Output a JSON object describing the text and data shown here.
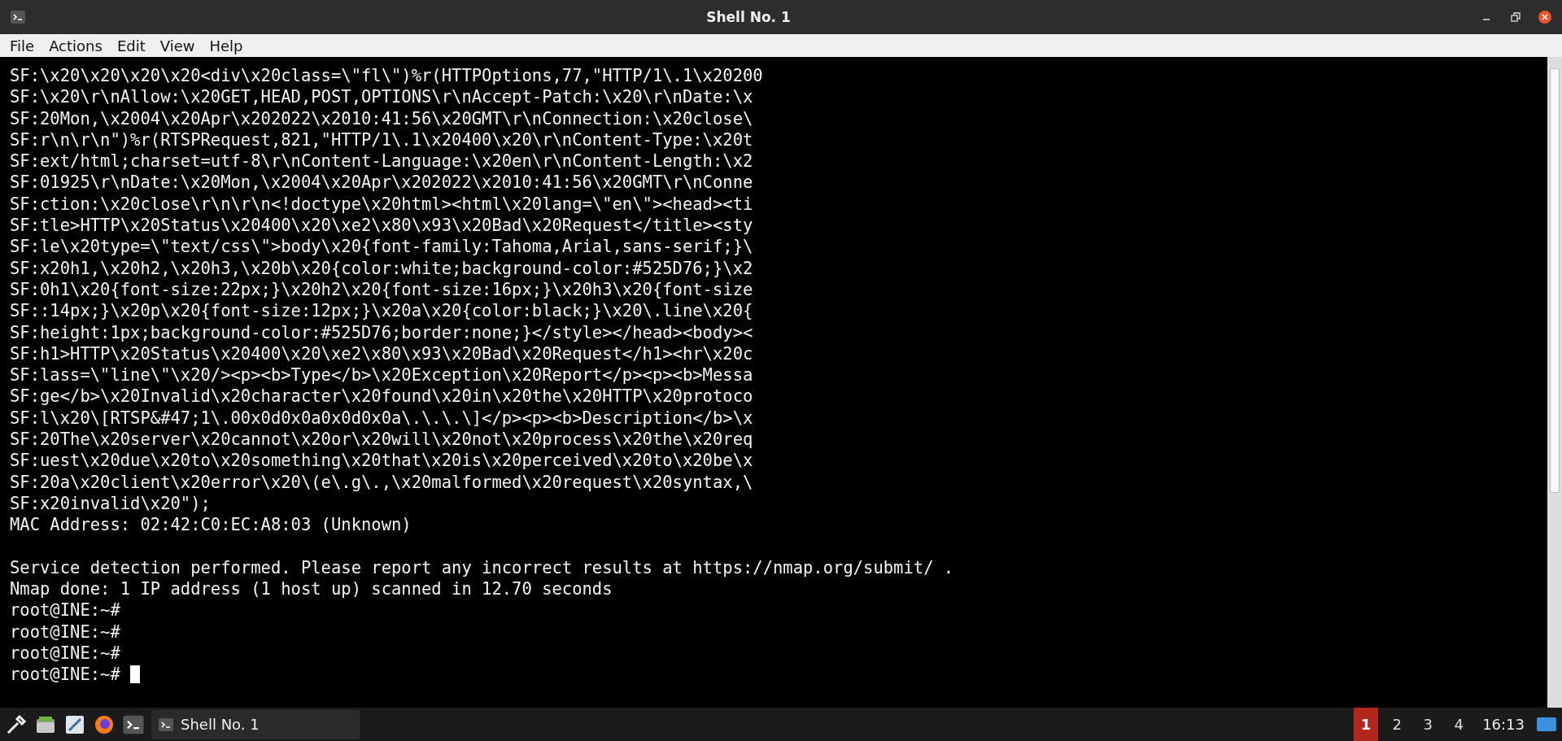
{
  "window": {
    "title": "Shell No. 1"
  },
  "menu": [
    "File",
    "Actions",
    "Edit",
    "View",
    "Help"
  ],
  "terminal": {
    "cursor_visible": true,
    "blocks": [
      [
        "SF:\\x20\\x20\\x20\\x20<div\\x20class=\\\"fl\\\")%r(HTTPOptions,77,\"HTTP/1\\.1\\x20200",
        "SF:\\x20\\r\\nAllow:\\x20GET,HEAD,POST,OPTIONS\\r\\nAccept-Patch:\\x20\\r\\nDate:\\x",
        "SF:20Mon,\\x2004\\x20Apr\\x202022\\x2010:41:56\\x20GMT\\r\\nConnection:\\x20close\\",
        "SF:r\\n\\r\\n\")%r(RTSPRequest,821,\"HTTP/1\\.1\\x20400\\x20\\r\\nContent-Type:\\x20t",
        "SF:ext/html;charset=utf-8\\r\\nContent-Language:\\x20en\\r\\nContent-Length:\\x2",
        "SF:01925\\r\\nDate:\\x20Mon,\\x2004\\x20Apr\\x202022\\x2010:41:56\\x20GMT\\r\\nConne",
        "SF:ction:\\x20close\\r\\n\\r\\n<!doctype\\x20html><html\\x20lang=\\\"en\\\"><head><ti",
        "SF:tle>HTTP\\x20Status\\x20400\\x20\\xe2\\x80\\x93\\x20Bad\\x20Request</title><sty",
        "SF:le\\x20type=\\\"text/css\\\">body\\x20{font-family:Tahoma,Arial,sans-serif;}\\",
        "SF:x20h1,\\x20h2,\\x20h3,\\x20b\\x20{color:white;background-color:#525D76;}\\x2",
        "SF:0h1\\x20{font-size:22px;}\\x20h2\\x20{font-size:16px;}\\x20h3\\x20{font-size",
        "SF::14px;}\\x20p\\x20{font-size:12px;}\\x20a\\x20{color:black;}\\x20\\.line\\x20{",
        "SF:height:1px;background-color:#525D76;border:none;}</style></head><body><",
        "SF:h1>HTTP\\x20Status\\x20400\\x20\\xe2\\x80\\x93\\x20Bad\\x20Request</h1><hr\\x20c",
        "SF:lass=\\\"line\\\"\\x20/><p><b>Type</b>\\x20Exception\\x20Report</p><p><b>Messa",
        "SF:ge</b>\\x20Invalid\\x20character\\x20found\\x20in\\x20the\\x20HTTP\\x20protoco",
        "SF:l\\x20\\[RTSP&#47;1\\.00x0d0x0a0x0d0x0a\\.\\.\\.\\]</p><p><b>Description</b>\\x",
        "SF:20The\\x20server\\x20cannot\\x20or\\x20will\\x20not\\x20process\\x20the\\x20req",
        "SF:uest\\x20due\\x20to\\x20something\\x20that\\x20is\\x20perceived\\x20to\\x20be\\x",
        "SF:20a\\x20client\\x20error\\x20\\(e\\.g\\.,\\x20malformed\\x20request\\x20syntax,\\",
        "SF:x20invalid\\x20\");",
        "MAC Address: 02:42:C0:EC:A8:03 (Unknown)"
      ],
      [
        "Service detection performed. Please report any incorrect results at https://nmap.org/submit/ .",
        "Nmap done: 1 IP address (1 host up) scanned in 12.70 seconds",
        "root@INE:~#",
        "root@INE:~#",
        "root@INE:~#",
        "root@INE:~#"
      ]
    ]
  },
  "taskbar": {
    "task": "Shell No. 1",
    "clock": "16:13",
    "workspaces": [
      {
        "label": "1",
        "selected": true
      },
      {
        "label": "2",
        "selected": false
      },
      {
        "label": "3",
        "selected": false
      },
      {
        "label": "4",
        "selected": false
      }
    ]
  }
}
